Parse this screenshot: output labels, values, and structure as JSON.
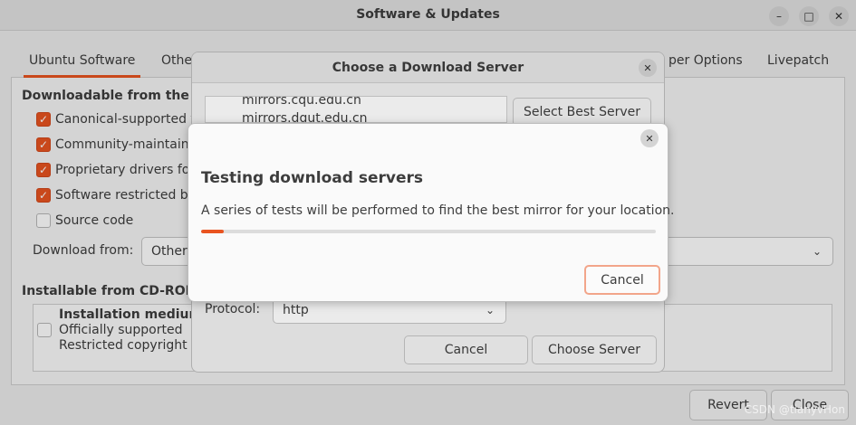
{
  "window": {
    "title": "Software & Updates",
    "controls": [
      "minimize-icon",
      "maximize-icon",
      "close-icon"
    ]
  },
  "tabs": [
    {
      "label": "Ubuntu Software",
      "active": true
    },
    {
      "label": "Othe",
      "active": false
    },
    {
      "label": "per Options",
      "active": false
    },
    {
      "label": "Livepatch",
      "active": false
    }
  ],
  "ubuntu_software": {
    "downloadable_heading": "Downloadable from the In",
    "options": [
      {
        "label": "Canonical-supported fr",
        "checked": true
      },
      {
        "label": "Community-maintaine",
        "checked": true
      },
      {
        "label": "Proprietary drivers fo",
        "checked": true
      },
      {
        "label": "Software restricted by",
        "checked": true
      },
      {
        "label": "Source code",
        "checked": false
      }
    ],
    "download_from_label": "Download from:",
    "download_from_value": "Other",
    "cdrom_heading": "Installable from CD-ROM/",
    "cdrom": {
      "title": "Installation medium",
      "line1": "Officially supported",
      "line2": "Restricted copyright",
      "checked": false
    }
  },
  "footer": {
    "revert": "Revert",
    "close": "Close"
  },
  "server_dialog": {
    "title": "Choose a Download Server",
    "mirrors": [
      "mirrors.cqu.edu.cn",
      "mirrors.dgut.edu.cn"
    ],
    "select_best": "Select Best Server",
    "protocol_label": "Protocol:",
    "protocol_value": "http",
    "cancel": "Cancel",
    "choose": "Choose Server"
  },
  "testing_dialog": {
    "heading": "Testing download servers",
    "message": "A series of tests will be performed to find the best mirror for your location.",
    "progress": 0.05,
    "cancel": "Cancel"
  },
  "colors": {
    "accent": "#e95420"
  },
  "watermark": "CSDN @tianyvHon"
}
